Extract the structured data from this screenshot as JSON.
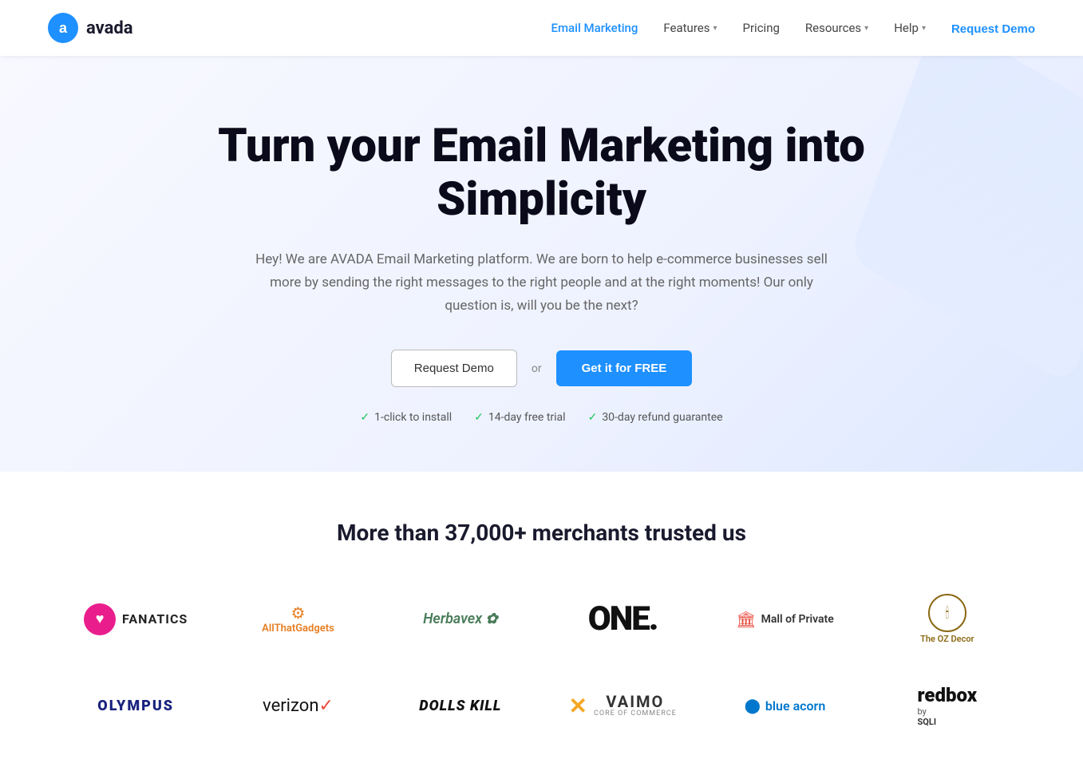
{
  "navbar": {
    "logo_text": "avada",
    "nav_items": [
      {
        "label": "Email Marketing",
        "active": true,
        "has_dropdown": false
      },
      {
        "label": "Features",
        "active": false,
        "has_dropdown": true
      },
      {
        "label": "Pricing",
        "active": false,
        "has_dropdown": false
      },
      {
        "label": "Resources",
        "active": false,
        "has_dropdown": true
      },
      {
        "label": "Help",
        "active": false,
        "has_dropdown": true
      }
    ],
    "cta_label": "Request Demo"
  },
  "hero": {
    "title": "Turn your Email Marketing into Simplicity",
    "subtitle": "Hey! We are AVADA Email Marketing platform. We are born to help e-commerce businesses sell more by sending the right messages to the right people and at the right moments! Our only question is, will you be the next?",
    "btn_demo": "Request Demo",
    "btn_or": "or",
    "btn_free": "Get it for FREE",
    "checks": [
      "1-click to install",
      "14-day free trial",
      "30-day refund guarantee"
    ]
  },
  "trusted": {
    "title": "More than 37,000+ merchants trusted us",
    "logos": [
      {
        "id": "fanatics",
        "name": "Fanatics",
        "type": "fanatics"
      },
      {
        "id": "allthatgadgets",
        "name": "AllThatGadgets",
        "type": "allthat"
      },
      {
        "id": "herbavex",
        "name": "Herbavex",
        "type": "herbavex"
      },
      {
        "id": "one",
        "name": "ONE.",
        "type": "one"
      },
      {
        "id": "mall-private",
        "name": "Mall of Private",
        "type": "mallprivate"
      },
      {
        "id": "oz-decor",
        "name": "The OZ Decor",
        "type": "ozdecor"
      },
      {
        "id": "olympus",
        "name": "OLYMPUS",
        "type": "olympus"
      },
      {
        "id": "verizon",
        "name": "verizon",
        "type": "verizon"
      },
      {
        "id": "dolls-kill",
        "name": "DOLLS KILL",
        "type": "dollskill"
      },
      {
        "id": "vaimo",
        "name": "VAIMO",
        "type": "vaimo"
      },
      {
        "id": "blue-acorn",
        "name": "blue acorn",
        "type": "blueacorn"
      },
      {
        "id": "redbox",
        "name": "redbox by SQLI",
        "type": "redbox"
      }
    ]
  },
  "colors": {
    "accent_blue": "#1e90ff",
    "green_check": "#22c55e",
    "text_dark": "#0a0a1a",
    "text_muted": "#666"
  }
}
